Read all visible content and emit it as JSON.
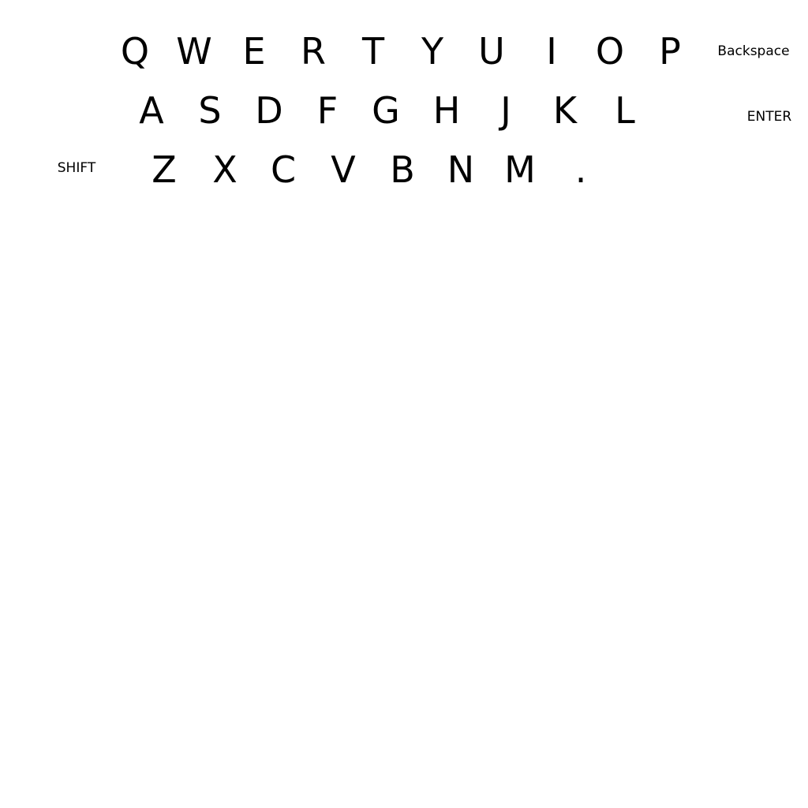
{
  "keyboard": {
    "row1": {
      "keys": [
        "Q",
        "W",
        "E",
        "R",
        "T",
        "Y",
        "U",
        "I",
        "O",
        "P"
      ],
      "backspace_label": "Backspace"
    },
    "row2": {
      "keys": [
        "A",
        "S",
        "D",
        "F",
        "G",
        "H",
        "J",
        "K",
        "L"
      ],
      "enter_label": "ENTER"
    },
    "row3": {
      "shift_label": "SHIFT",
      "keys": [
        "Z",
        "X",
        "C",
        "V",
        "B",
        "N",
        "M",
        "."
      ]
    }
  }
}
